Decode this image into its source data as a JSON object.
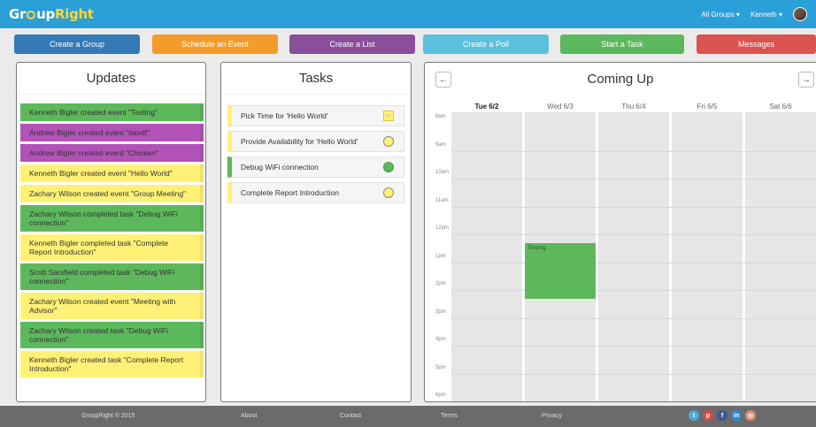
{
  "navbar": {
    "brand_part1": "Gr",
    "brand_part2": "up",
    "brand_part3": "Right",
    "groups_label": "All Groups ▾",
    "user_label": "Kenneth ▾"
  },
  "actions": [
    {
      "label": "Create a Group",
      "color": "#337ab7"
    },
    {
      "label": "Schedule an Event",
      "color": "#f39c2b"
    },
    {
      "label": "Create a List",
      "color": "#8a4f9b"
    },
    {
      "label": "Create a Poll",
      "color": "#5bc0de"
    },
    {
      "label": "Start a Task",
      "color": "#5cb85c"
    },
    {
      "label": "Messages",
      "color": "#d9534f"
    }
  ],
  "updates": {
    "title": "Updates",
    "items": [
      {
        "text": "Kenneth Bigler created event \"Testing\"",
        "color": "green"
      },
      {
        "text": "Andrew Bigler created event \"dasdf\"",
        "color": "purple"
      },
      {
        "text": "Andrew Bigler created event \"Chicken\"",
        "color": "purple"
      },
      {
        "text": "Kenneth Bigler created event \"Hello World\"",
        "color": "yellow"
      },
      {
        "text": "Zachary Wilson created event \"Group Meeting\"",
        "color": "yellow"
      },
      {
        "text": "Zachary Wilson completed task \"Debug WiFi connection\"",
        "color": "green"
      },
      {
        "text": "Kenneth Bigler completed task \"Complete Report Introduction\"",
        "color": "yellow"
      },
      {
        "text": "Scott Sarsfield completed task \"Debug WiFi connection\"",
        "color": "green"
      },
      {
        "text": "Zachary Wilson created event \"Meeting with Advisor\"",
        "color": "yellow"
      },
      {
        "text": "Zachary Wilson created task \"Debug WiFi connection\"",
        "color": "green"
      },
      {
        "text": "Kenneth Bigler created task \"Complete Report Introduction\"",
        "color": "yellow"
      }
    ]
  },
  "tasks": {
    "title": "Tasks",
    "items": [
      {
        "text": "Pick Time for 'Hello World'",
        "status": "box",
        "color": "yellow"
      },
      {
        "text": "Provide Availability for 'Hello World'",
        "status": "circle",
        "color": "yellow"
      },
      {
        "text": "Debug WiFi connection",
        "status": "circle-done",
        "color": "green"
      },
      {
        "text": "Complete Report Introduction",
        "status": "circle",
        "color": "yellow"
      }
    ]
  },
  "coming_up": {
    "title": "Coming Up",
    "prev_label": "←",
    "next_label": "→",
    "days": [
      {
        "label": "Tue 6/2",
        "today": true
      },
      {
        "label": "Wed 6/3",
        "today": false
      },
      {
        "label": "Thu 6/4",
        "today": false
      },
      {
        "label": "Fri 6/5",
        "today": false
      },
      {
        "label": "Sat 6/6",
        "today": false
      }
    ],
    "hours": [
      "8am",
      "9am",
      "10am",
      "11am",
      "12pm",
      "1pm",
      "2pm",
      "3pm",
      "4pm",
      "5pm",
      "6pm"
    ],
    "events": [
      {
        "title": "Testing",
        "day": "Wed 6/3",
        "start": "1pm",
        "end": "3pm",
        "color": "#5db85c"
      }
    ]
  },
  "footer": {
    "copyright": "GroupRight © 2015",
    "about": "About",
    "contact": "Contact",
    "terms": "Terms",
    "privacy": "Privacy",
    "social": [
      {
        "icon": "twitter-icon",
        "glyph": "t",
        "color": "#4aa8d8"
      },
      {
        "icon": "pinterest-icon",
        "glyph": "p",
        "color": "#d84a4a"
      },
      {
        "icon": "facebook-icon",
        "glyph": "f",
        "color": "#3b5998"
      },
      {
        "icon": "linkedin-icon",
        "glyph": "in",
        "color": "#2a8ad8"
      },
      {
        "icon": "instagram-icon",
        "glyph": "◎",
        "color": "#e08a7a"
      }
    ]
  }
}
